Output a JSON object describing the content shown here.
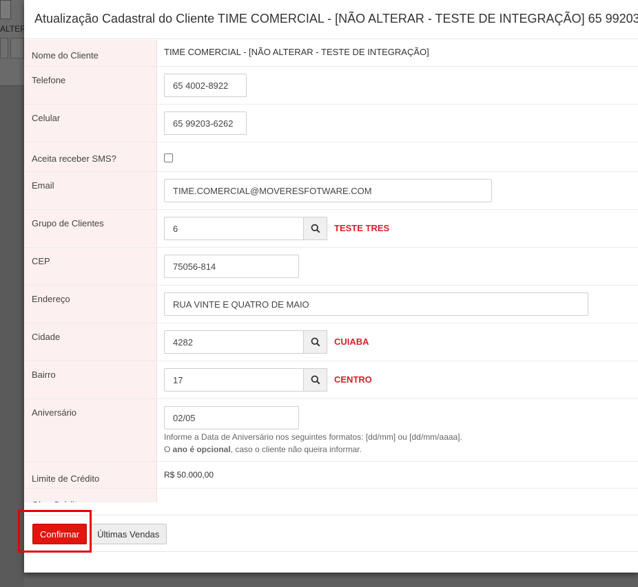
{
  "background": {
    "label": "ALTER"
  },
  "modal": {
    "title": "Atualização Cadastral do Cliente TIME COMERCIAL - [NÃO ALTERAR - TESTE DE INTEGRAÇÃO] 65 99203"
  },
  "form": {
    "nome": {
      "label": "Nome do Cliente",
      "value": "TIME COMERCIAL - [NÃO ALTERAR - TESTE DE INTEGRAÇÃO]"
    },
    "telefone": {
      "label": "Telefone",
      "value": "65 4002-8922"
    },
    "celular": {
      "label": "Celular",
      "value": "65 99203-6262"
    },
    "sms": {
      "label": "Aceita receber SMS?",
      "checked": false
    },
    "email": {
      "label": "Email",
      "value": "TIME.COMERCIAL@MOVERESFOTWARE.COM"
    },
    "grupo": {
      "label": "Grupo de Clientes",
      "value": "6",
      "description": "TESTE TRES"
    },
    "cep": {
      "label": "CEP",
      "value": "75056-814"
    },
    "endereco": {
      "label": "Endereço",
      "value": "RUA VINTE E QUATRO DE MAIO"
    },
    "cidade": {
      "label": "Cidade",
      "value": "4282",
      "description": "CUIABA"
    },
    "bairro": {
      "label": "Bairro",
      "value": "17",
      "description": "CENTRO"
    },
    "aniversario": {
      "label": "Aniversário",
      "value": "02/05",
      "help_line1": "Informe a Data de Aniversário nos seguintes formatos: [dd/mm] ou [dd/mm/aaaa].",
      "help_line2_prefix": "O ",
      "help_line2_bold": "ano é opcional",
      "help_line2_suffix": ", caso o cliente não queira informar."
    },
    "limite": {
      "label": "Limite de Crédito",
      "value": "R$ 50.000,00"
    },
    "obs": {
      "label": "Obs. Crédito"
    }
  },
  "footer": {
    "confirm_label": "Confirmar",
    "sales_label": "Últimas Vendas"
  },
  "colors": {
    "accent_red": "#e2140c",
    "label_bg": "#fdf0f0",
    "highlight": "#e60000"
  },
  "icons": {
    "search": "search-icon"
  }
}
